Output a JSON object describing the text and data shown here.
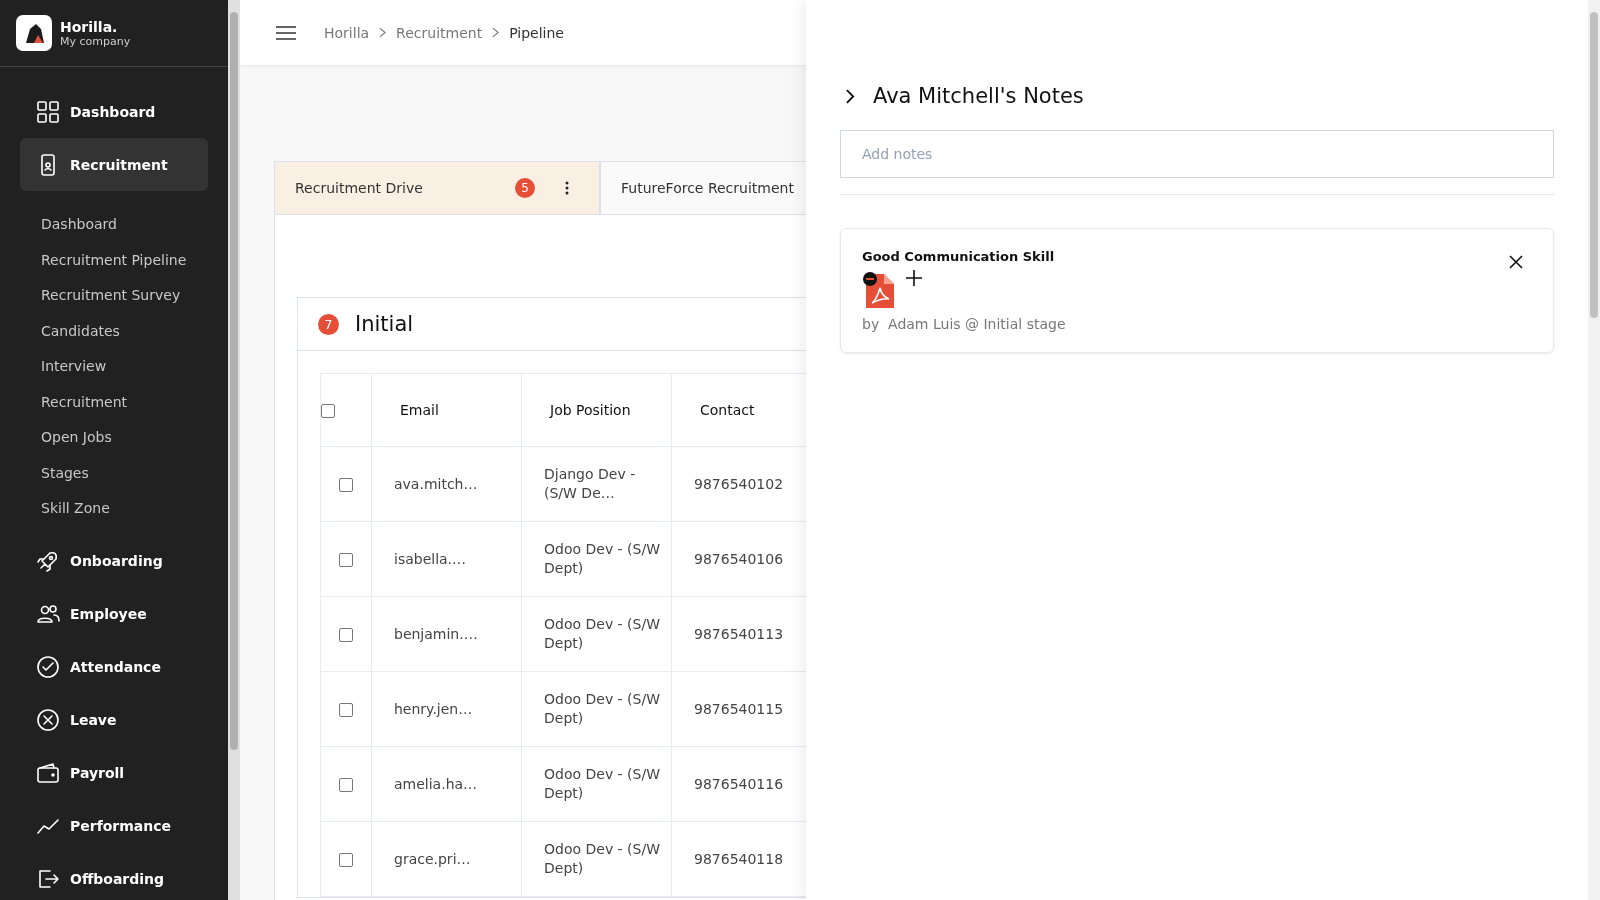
{
  "brand": {
    "name": "Horilla.",
    "company": "My company"
  },
  "sidebar": {
    "items": [
      {
        "label": "Dashboard",
        "selected": false
      },
      {
        "label": "Recruitment",
        "selected": true,
        "expanded": true,
        "children": [
          {
            "label": "Dashboard"
          },
          {
            "label": "Recruitment Pipeline"
          },
          {
            "label": "Recruitment Survey"
          },
          {
            "label": "Candidates"
          },
          {
            "label": "Interview"
          },
          {
            "label": "Recruitment"
          },
          {
            "label": "Open Jobs"
          },
          {
            "label": "Stages"
          },
          {
            "label": "Skill Zone"
          }
        ]
      },
      {
        "label": "Onboarding",
        "selected": false
      },
      {
        "label": "Employee",
        "selected": false
      },
      {
        "label": "Attendance",
        "selected": false
      },
      {
        "label": "Leave",
        "selected": false
      },
      {
        "label": "Payroll",
        "selected": false
      },
      {
        "label": "Performance",
        "selected": false
      },
      {
        "label": "Offboarding",
        "selected": false
      }
    ]
  },
  "breadcrumb": [
    "Horilla",
    "Recruitment",
    "Pipeline"
  ],
  "tabs": [
    {
      "label": "Recruitment Drive",
      "count": "5",
      "selected": true
    },
    {
      "label": "FutureForce Recruitment",
      "selected": false
    }
  ],
  "stage": {
    "title": "Initial",
    "count": "7"
  },
  "table": {
    "columns": [
      "Email",
      "Job Position",
      "Contact"
    ],
    "select_all": false,
    "rows": [
      {
        "checked": false,
        "cells": [
          "ava.mitch…",
          "Django Dev - (S/W De…",
          "9876540102"
        ]
      },
      {
        "checked": false,
        "cells": [
          "isabella.…",
          "Odoo Dev - (S/W Dept)",
          "9876540106"
        ]
      },
      {
        "checked": false,
        "cells": [
          "benjamin.…",
          "Odoo Dev - (S/W Dept)",
          "9876540113"
        ]
      },
      {
        "checked": false,
        "cells": [
          "henry.jen…",
          "Odoo Dev - (S/W Dept)",
          "9876540115"
        ]
      },
      {
        "checked": false,
        "cells": [
          "amelia.ha…",
          "Odoo Dev - (S/W Dept)",
          "9876540116"
        ]
      },
      {
        "checked": false,
        "cells": [
          "grace.pri…",
          "Odoo Dev - (S/W Dept)",
          "9876540118"
        ]
      }
    ]
  },
  "notes_panel": {
    "title": "Ava Mitchell's Notes",
    "input": {
      "placeholder": "Add notes"
    },
    "notes": [
      {
        "title": "Good Communication Skill",
        "by": "by",
        "author": "Adam Luis @ Initial stage"
      }
    ]
  }
}
